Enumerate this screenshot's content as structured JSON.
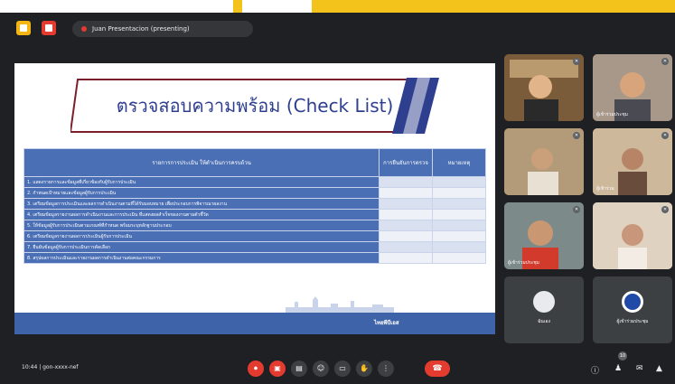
{
  "header": {
    "presenting_label": "Juan Presentacion (presenting)"
  },
  "slide": {
    "title": "ตรวจสอบความพร้อม (Check List)",
    "table": {
      "headers": [
        "รายการการประเมิน ให้ดำเนินการครบถ้วน",
        "การยืนยันการตรวจ",
        "หมายเหตุ"
      ],
      "items": [
        "1. แสดงรายการและข้อมูลที่เกี่ยวข้องกับผู้รับการประเมิน",
        "2. กำหนดเป้าหมายและข้อมูลผู้รับการประเมิน",
        "3. เตรียมข้อมูลการประเมินและผลการดำเนินงานตามที่ได้รับมอบหมาย เพื่อประกอบการพิจารณาผลงาน",
        "4. เตรียมข้อมูลรายงานผลการดำเนินงานและการประเมิน ที่แสดงผลสำเร็จของงานตามตัวชี้วัด",
        "5. ให้ข้อมูลผู้รับการประเมินตามเกณฑ์ที่กำหนด พร้อมระบุหลักฐานประกอบ",
        "6. เตรียมข้อมูลรายงานผลการประเมินผู้รับการประเมิน",
        "7. ยืนยันข้อมูลผู้รับการประเมินการคัดเลือก",
        "8. สรุปผลการประเมินและรายงานผลการดำเนินงานต่อคณะกรรมการ"
      ]
    },
    "footer_logo": "ไทยพีบีเอส"
  },
  "participants": [
    {
      "name": "",
      "bg": "#8a6a44"
    },
    {
      "name": "ผู้เข้าร่วมประชุม",
      "bg": "#9a8a7c"
    },
    {
      "name": "",
      "bg": "#a88f6e"
    },
    {
      "name": "ผู้เข้าร่วม",
      "bg": "#c8b49a"
    },
    {
      "name": "ผู้เข้าร่วมประชุม",
      "bg": "#6e7a7c"
    },
    {
      "name": "",
      "bg": "#d8c4ae"
    },
    {
      "name": "ฉันเอง",
      "bg": "#3c4043"
    },
    {
      "name": "ผู้เข้าร่วมประชุม",
      "bg": "#3c4043"
    }
  ],
  "footer": {
    "meeting_info": "10:44 | gon-xxxx-nef",
    "participant_count": "10"
  },
  "colors": {
    "accent_yellow": "#f3c21b",
    "slide_blue": "#4a6fb5",
    "title_navy": "#2f3f8f",
    "end_red": "#e33b2f"
  }
}
